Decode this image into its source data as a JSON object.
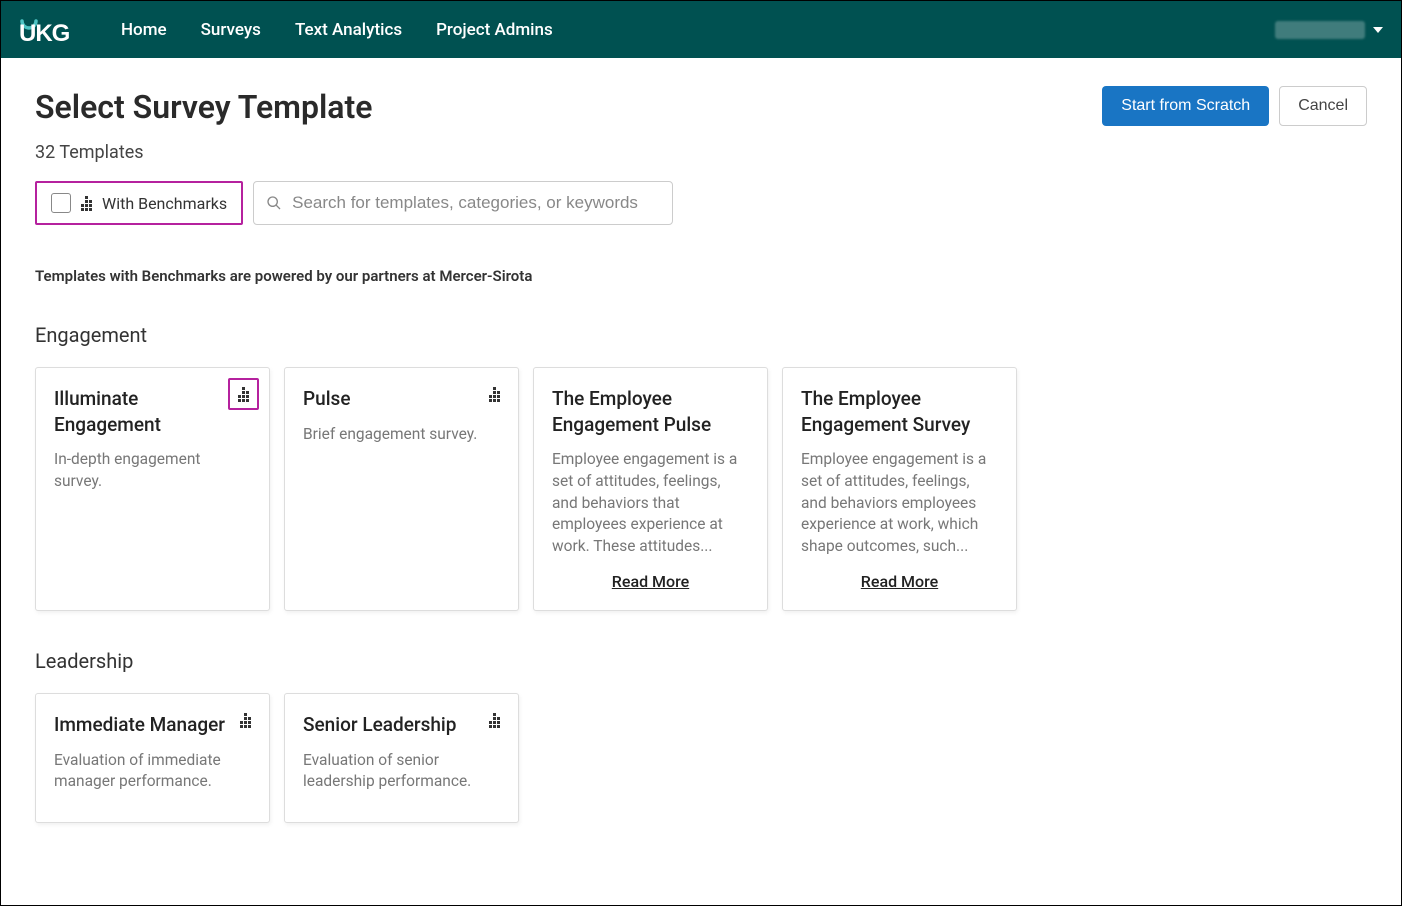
{
  "brand": "UKG",
  "nav": {
    "items": [
      "Home",
      "Surveys",
      "Text Analytics",
      "Project Admins"
    ]
  },
  "page": {
    "title": "Select Survey Template",
    "count": "32 Templates",
    "note": "Templates with Benchmarks are powered by our partners at Mercer-Sirota"
  },
  "actions": {
    "primary": "Start from Scratch",
    "secondary": "Cancel"
  },
  "filter": {
    "benchmarks_label": "With Benchmarks"
  },
  "search": {
    "placeholder": "Search for templates, categories, or keywords"
  },
  "sections": [
    {
      "title": "Engagement",
      "cards": [
        {
          "title": "Illuminate Engagement",
          "desc": "In-depth engagement survey.",
          "benchmark": true,
          "highlight": true
        },
        {
          "title": "Pulse",
          "desc": "Brief engagement survey.",
          "benchmark": true
        },
        {
          "title": "The Employee Engagement Pulse",
          "desc": "Employee engagement is a set of attitudes, feelings, and behaviors that employees experience at work. These attitudes...",
          "read_more": "Read More"
        },
        {
          "title": "The Employee Engagement Survey",
          "desc": "Employee engagement is a set of attitudes, feelings, and behaviors employees experience at work, which shape outcomes, such...",
          "read_more": "Read More"
        }
      ]
    },
    {
      "title": "Leadership",
      "cards": [
        {
          "title": "Immediate Manager",
          "desc": "Evaluation of immediate manager performance.",
          "benchmark": true
        },
        {
          "title": "Senior Leadership",
          "desc": "Evaluation of senior leadership performance.",
          "benchmark": true
        }
      ]
    }
  ]
}
